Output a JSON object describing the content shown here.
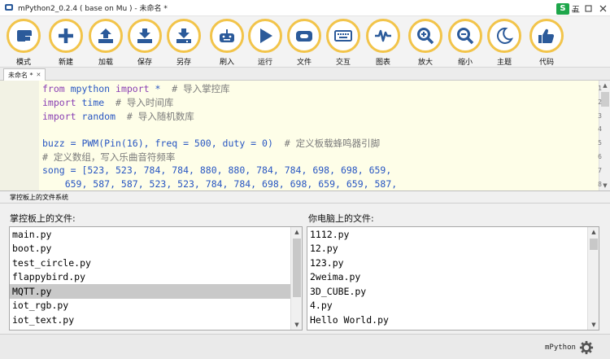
{
  "window": {
    "title": "mPython2_0.2.4 ( base on Mu ) - 未命名 *",
    "tray_label": "五"
  },
  "toolbar": [
    {
      "label": "模式",
      "icon": "mode-icon"
    },
    {
      "label": "新建",
      "icon": "plus-icon"
    },
    {
      "label": "加载",
      "icon": "upload-icon"
    },
    {
      "label": "保存",
      "icon": "save-icon"
    },
    {
      "label": "另存",
      "icon": "save-as-icon"
    },
    {
      "label": "刷入",
      "icon": "flash-icon"
    },
    {
      "label": "运行",
      "icon": "play-icon"
    },
    {
      "label": "文件",
      "icon": "files-icon"
    },
    {
      "label": "交互",
      "icon": "keyboard-icon"
    },
    {
      "label": "图表",
      "icon": "plotter-icon"
    },
    {
      "label": "放大",
      "icon": "zoom-in-icon"
    },
    {
      "label": "缩小",
      "icon": "zoom-out-icon"
    },
    {
      "label": "主题",
      "icon": "moon-icon"
    },
    {
      "label": "代码",
      "icon": "thumbs-up-icon"
    }
  ],
  "editor": {
    "tab": "未命名 *",
    "lines": [
      {
        "n": "1",
        "parts": [
          [
            "kw",
            "from"
          ],
          [
            "txt",
            " mpython "
          ],
          [
            "kw",
            "import"
          ],
          [
            "txt",
            " *"
          ],
          [
            "cm",
            "  # 导入掌控库"
          ]
        ]
      },
      {
        "n": "2",
        "parts": [
          [
            "kw",
            "import"
          ],
          [
            "txt",
            " time"
          ],
          [
            "cm",
            "  # 导入时间库"
          ]
        ]
      },
      {
        "n": "3",
        "parts": [
          [
            "kw",
            "import"
          ],
          [
            "txt",
            " random"
          ],
          [
            "cm",
            "  # 导入随机数库"
          ]
        ]
      },
      {
        "n": "4",
        "parts": []
      },
      {
        "n": "5",
        "parts": [
          [
            "txt",
            "buzz = PWM(Pin(16), freq = 500, duty = 0)"
          ],
          [
            "cm",
            "  # 定义板载蜂鸣器引脚"
          ]
        ]
      },
      {
        "n": "6",
        "parts": [
          [
            "cm",
            "# 定义数组，写入乐曲音符频率"
          ]
        ]
      },
      {
        "n": "7",
        "parts": [
          [
            "txt",
            "song = [523, 523, 784, 784, 880, 880, 784, 784, 698, 698, 659,"
          ]
        ]
      },
      {
        "n": "8",
        "parts": [
          [
            "txt",
            "    659, 587, 587, 523, 523, 784, 784, 698, 698, 659, 659, 587,"
          ]
        ]
      }
    ]
  },
  "files": {
    "header": "掌控板上的文件系统",
    "device_title": "掌控板上的文件:",
    "device_files": [
      "main.py",
      "boot.py",
      "test_circle.py",
      "flappybird.py",
      "MQTT.py",
      "iot_rgb.py",
      "iot_text.py"
    ],
    "device_selected": "MQTT.py",
    "local_title": "你电脑上的文件:",
    "local_files": [
      "1112.py",
      "12.py",
      "123.py",
      "2weima.py",
      "3D_CUBE.py",
      "4.py",
      "Hello World.py"
    ]
  },
  "status": {
    "mode": "mPython"
  },
  "colors": {
    "accent": "#f2c44a",
    "icon": "#2b5a9a",
    "editor_bg": "#fefee8"
  }
}
